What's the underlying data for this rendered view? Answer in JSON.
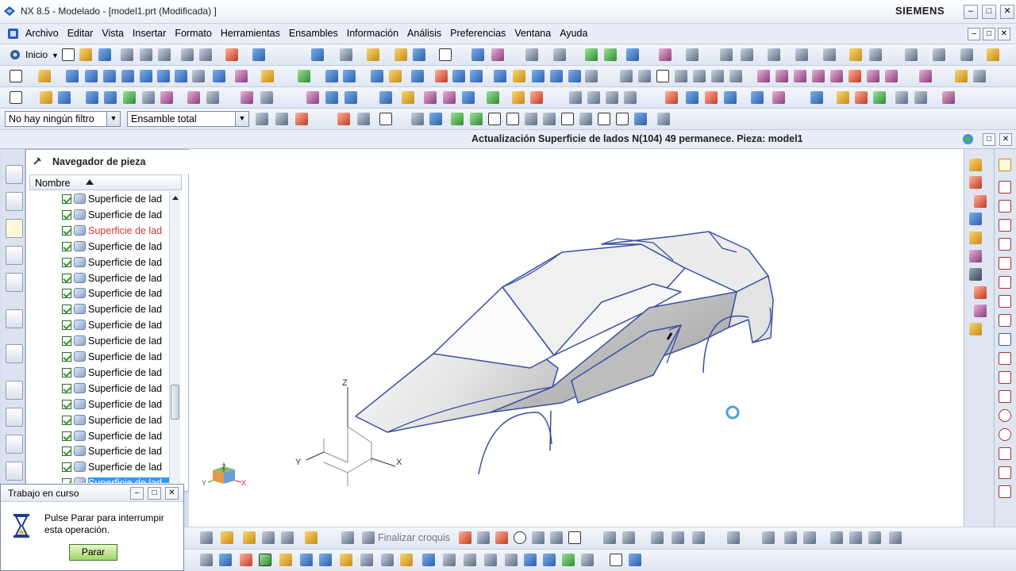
{
  "window": {
    "title": "NX 8.5 - Modelado - [model1.prt (Modificada) ]",
    "brand": "SIEMENS",
    "min_glyph": "–",
    "max_glyph": "□",
    "close_glyph": "✕"
  },
  "menu": {
    "items": [
      "Archivo",
      "Editar",
      "Vista",
      "Insertar",
      "Formato",
      "Herramientas",
      "Ensambles",
      "Información",
      "Análisis",
      "Preferencias",
      "Ventana",
      "Ayuda"
    ]
  },
  "toolbar1": {
    "start_label": "Inicio"
  },
  "selection_bar": {
    "filter_value": "No hay ningún filtro",
    "scope_value": "Ensamble total"
  },
  "status": {
    "message": "Actualización Superficie de lados N(104) 49 permanece. Pieza: model1"
  },
  "navigator": {
    "title": "Navegador de pieza",
    "column_header": "Nombre",
    "rows": [
      {
        "label": "Superficie de lad",
        "state": "normal"
      },
      {
        "label": "Superficie de lad",
        "state": "normal"
      },
      {
        "label": "Superficie de lad",
        "state": "highlight"
      },
      {
        "label": "Superficie de lad",
        "state": "normal"
      },
      {
        "label": "Superficie de lad",
        "state": "normal"
      },
      {
        "label": "Superficie de lad",
        "state": "normal"
      },
      {
        "label": "Superficie de lad",
        "state": "normal"
      },
      {
        "label": "Superficie de lad",
        "state": "normal"
      },
      {
        "label": "Superficie de lad",
        "state": "normal"
      },
      {
        "label": "Superficie de lad",
        "state": "normal"
      },
      {
        "label": "Superficie de lad",
        "state": "normal"
      },
      {
        "label": "Superficie de lad",
        "state": "normal"
      },
      {
        "label": "Superficie de lad",
        "state": "normal"
      },
      {
        "label": "Superficie de lad",
        "state": "normal"
      },
      {
        "label": "Superficie de lad",
        "state": "normal"
      },
      {
        "label": "Superficie de lad",
        "state": "normal"
      },
      {
        "label": "Superficie de lad",
        "state": "normal"
      },
      {
        "label": "Superficie de lad",
        "state": "normal"
      },
      {
        "label": "Superficie de lad",
        "state": "selected"
      }
    ]
  },
  "graphics": {
    "axes": {
      "x": "X",
      "y": "Y",
      "z": "Z"
    },
    "mini_axes": {
      "x": "X",
      "y": "Y",
      "z": "Z"
    }
  },
  "sketch_bar": {
    "finish_label": "Finalizar croquis"
  },
  "progress_dialog": {
    "title": "Trabajo en curso",
    "message": "Pulse Parar para interrumpir esta operación.",
    "stop_label": "Parar"
  },
  "colors": {
    "title_bg": "#e9eef7",
    "accent_blue": "#2b5fae",
    "wire_blue": "#3a4fa0",
    "highlight_red": "#d2372d",
    "selection_blue": "#3399ff",
    "stop_green": "#9fd56a"
  }
}
